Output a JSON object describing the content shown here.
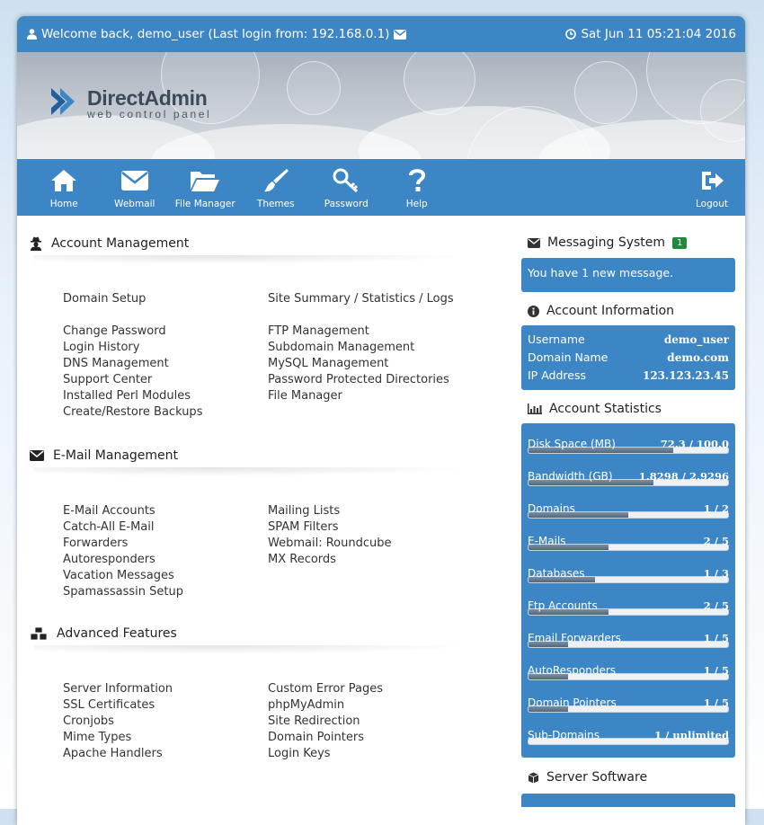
{
  "topbar": {
    "welcome": "Welcome back, demo_user (Last login from: 192.168.0.1)",
    "datetime": "Sat Jun 11 05:21:04 2016"
  },
  "logo": {
    "name": "DirectAdmin",
    "subtitle": "web control panel"
  },
  "nav": [
    {
      "label": "Home",
      "icon": "home-icon"
    },
    {
      "label": "Webmail",
      "icon": "envelope-icon"
    },
    {
      "label": "File Manager",
      "icon": "folder-open-icon"
    },
    {
      "label": "Themes",
      "icon": "paintbrush-icon"
    },
    {
      "label": "Password",
      "icon": "key-icon"
    },
    {
      "label": "Help",
      "icon": "question-icon"
    }
  ],
  "logout": {
    "label": "Logout",
    "icon": "logout-icon"
  },
  "sections": {
    "account": {
      "title": "Account Management",
      "icon": "user-secret-icon",
      "left": [
        "Domain Setup",
        "",
        "Change Password",
        "Login History",
        "DNS Management",
        "Support Center",
        "Installed Perl Modules",
        "Create/Restore Backups"
      ],
      "right": [
        "Site Summary / Statistics / Logs",
        "",
        "FTP Management",
        "Subdomain Management",
        "MySQL Management",
        "Password Protected Directories",
        "File Manager"
      ]
    },
    "email": {
      "title": "E-Mail Management",
      "icon": "envelope-icon",
      "left": [
        "E-Mail Accounts",
        "Catch-All E-Mail",
        "Forwarders",
        "Autoresponders",
        "Vacation Messages",
        "Spamassassin Setup"
      ],
      "right": [
        "Mailing Lists",
        "SPAM Filters",
        "Webmail: Roundcube",
        "MX Records"
      ]
    },
    "advanced": {
      "title": "Advanced Features",
      "icon": "cubes-icon",
      "left": [
        "Server Information",
        "SSL Certificates",
        "Cronjobs",
        "Mime Types",
        "Apache Handlers"
      ],
      "right": [
        "Custom Error Pages",
        "phpMyAdmin",
        "Site Redirection",
        "Domain Pointers",
        "Login Keys"
      ]
    }
  },
  "sidebar": {
    "messaging": {
      "title": "Messaging System",
      "badge": "1",
      "message": "You have 1 new message."
    },
    "account_info": {
      "title": "Account Information",
      "rows": [
        {
          "label": "Username",
          "value": "demo_user"
        },
        {
          "label": "Domain Name",
          "value": "demo.com"
        },
        {
          "label": "IP Address",
          "value": "123.123.23.45"
        }
      ]
    },
    "statistics": {
      "title": "Account Statistics",
      "items": [
        {
          "label": "Disk Space (MB)",
          "value": "72.3 / 100.0",
          "fraction": 0.723
        },
        {
          "label": "Bandwidth (GB)",
          "value": "1.8298 / 2.9296",
          "fraction": 0.625
        },
        {
          "label": "Domains",
          "value": "1 / 2",
          "fraction": 0.5
        },
        {
          "label": "E-Mails",
          "value": "2 / 5",
          "fraction": 0.4
        },
        {
          "label": "Databases",
          "value": "1 / 3",
          "fraction": 0.333
        },
        {
          "label": "Ftp Accounts",
          "value": "2 / 5",
          "fraction": 0.4
        },
        {
          "label": "Email Forwarders",
          "value": "1 / 5",
          "fraction": 0.2
        },
        {
          "label": "AutoResponders",
          "value": "1 / 5",
          "fraction": 0.2
        },
        {
          "label": "Domain Pointers",
          "value": "1 / 5",
          "fraction": 0.2
        },
        {
          "label": "Sub-Domains",
          "value": "1 / unlimited",
          "fraction": 0.0
        }
      ]
    },
    "server_software": {
      "title": "Server Software"
    }
  },
  "colors": {
    "accent": "#3d86c6",
    "badge": "#1f8a3b",
    "bar_fill": "#5d7188"
  }
}
